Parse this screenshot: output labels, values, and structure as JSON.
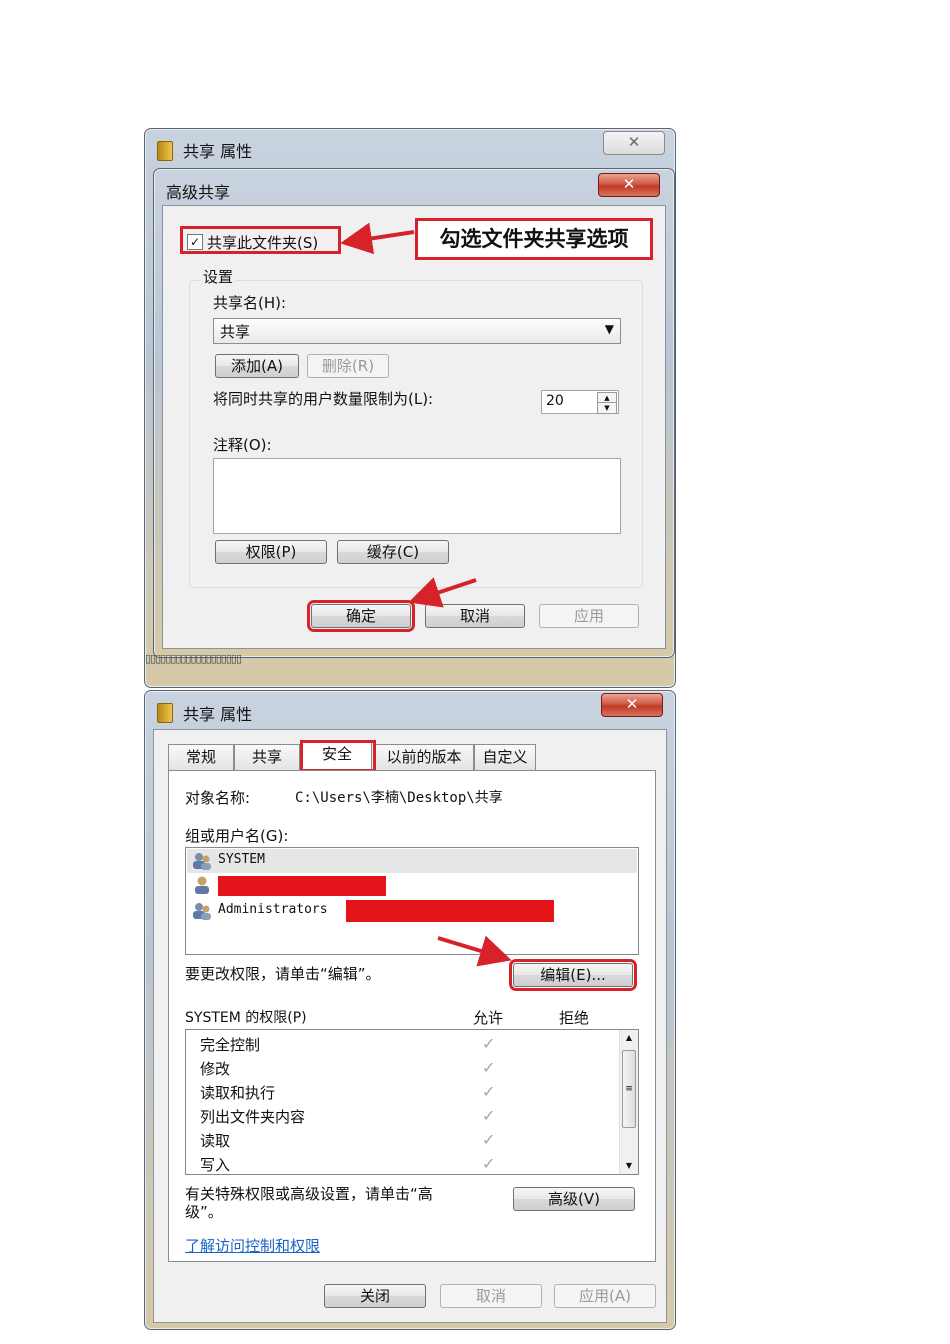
{
  "background_window": {
    "title": "共享 属性",
    "close": "✕"
  },
  "advanced_dialog": {
    "title": "高级共享",
    "close": "✕",
    "share_checkbox_label": "共享此文件夹(S)",
    "share_checked": true,
    "callout": "勾选文件夹共享选项",
    "settings_group": "设置",
    "share_name_label": "共享名(H):",
    "share_name_value": "共享",
    "add_button": "添加(A)",
    "remove_button": "删除(R)",
    "user_limit_label": "将同时共享的用户数量限制为(L):",
    "user_limit_value": "20",
    "comment_label": "注释(O):",
    "comment_value": "",
    "permissions_button": "权限(P)",
    "cache_button": "缓存(C)",
    "ok_button": "确定",
    "cancel_button": "取消",
    "apply_button": "应用"
  },
  "garbled_strip": "▯▯▯▯▯▯▯▯▯▯▯▯▯▯▯▯▯▯▯",
  "properties_dialog": {
    "title": "共享 属性",
    "close": "✕",
    "tabs": [
      "常规",
      "共享",
      "安全",
      "以前的版本",
      "自定义"
    ],
    "active_tab": "安全",
    "object_name_label": "对象名称:",
    "object_name_value": "C:\\Users\\李楠\\Desktop\\共享",
    "group_label": "组或用户名(G):",
    "users": [
      {
        "name": "SYSTEM",
        "icon": "group-users-icon"
      },
      {
        "name": "",
        "icon": "single-user-icon"
      },
      {
        "name": "Administrators",
        "icon": "group-users-icon"
      }
    ],
    "edit_hint": "要更改权限，请单击“编辑”。",
    "edit_button": "编辑(E)...",
    "perm_header": "SYSTEM 的权限(P)",
    "allow_header": "允许",
    "deny_header": "拒绝",
    "permissions": [
      {
        "name": "完全控制",
        "allow": true
      },
      {
        "name": "修改",
        "allow": true
      },
      {
        "name": "读取和执行",
        "allow": true
      },
      {
        "name": "列出文件夹内容",
        "allow": true
      },
      {
        "name": "读取",
        "allow": true
      },
      {
        "name": "写入",
        "allow": true
      }
    ],
    "advanced_hint_line1": "有关特殊权限或高级设置，请单击“高",
    "advanced_hint_line2": "级”。",
    "advanced_button": "高级(V)",
    "learn_link": "了解访问控制和权限",
    "close_button": "关闭",
    "cancel_button": "取消",
    "apply_button": "应用(A)"
  },
  "colors": {
    "highlight_red": "#d8222a",
    "link_blue": "#1a63c6"
  }
}
